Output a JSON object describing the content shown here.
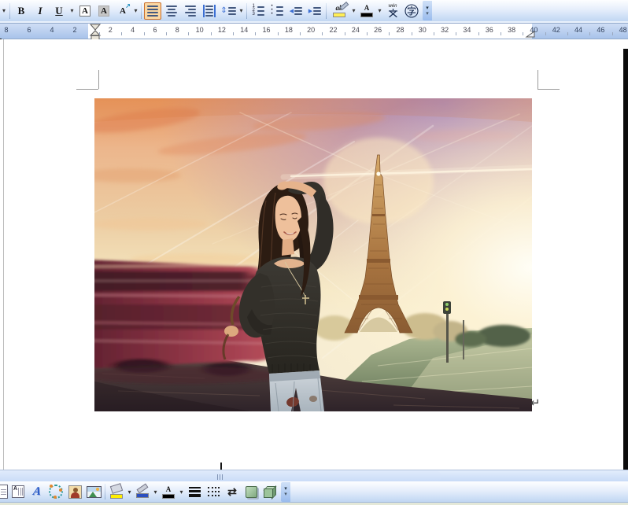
{
  "formatting_toolbar": {
    "bold_label": "B",
    "italic_label": "I",
    "underline_label": "U",
    "char_border_label": "A",
    "char_shading_label": "A",
    "char_scaling_label": "A",
    "char_scaling_arrow": "↗",
    "highlight_label": "ab",
    "font_color_label": "A",
    "phonetic_pinyin": "wén",
    "phonetic_char": "文",
    "enclose_char_label": "字"
  },
  "ruler": {
    "left_numbers": [
      "8",
      "6",
      "4",
      "2"
    ],
    "main_numbers": [
      "2",
      "4",
      "6",
      "8",
      "10",
      "12",
      "14",
      "16",
      "18",
      "20",
      "22",
      "24",
      "26",
      "28",
      "30",
      "32",
      "34",
      "36",
      "38"
    ],
    "right_numbers": [
      "40",
      "42",
      "44",
      "46",
      "48"
    ]
  },
  "document": {
    "paragraph_mark": "↵",
    "picture_alt": "Young woman with dark hair in a loose dark sweater and ripped jeans posing in front of the Eiffel Tower at sunset, with a motion-blurred red double-decker bus passing on the left"
  },
  "drawing_toolbar": {
    "wordart_label": "A",
    "font_color_label": "A",
    "arrow_style_glyph": "⇄"
  },
  "colors": {
    "selected_button_bg": "#fbd7a2",
    "selected_button_border": "#c96f2c",
    "highlight_yellow": "#ffee55",
    "fill_color_yellow": "#ffee00",
    "line_color_blue": "#2b4fc0",
    "font_color_black": "#000000",
    "toolbar_blue_top": "#fdfeff",
    "toolbar_blue_bottom": "#c2d7f2"
  }
}
